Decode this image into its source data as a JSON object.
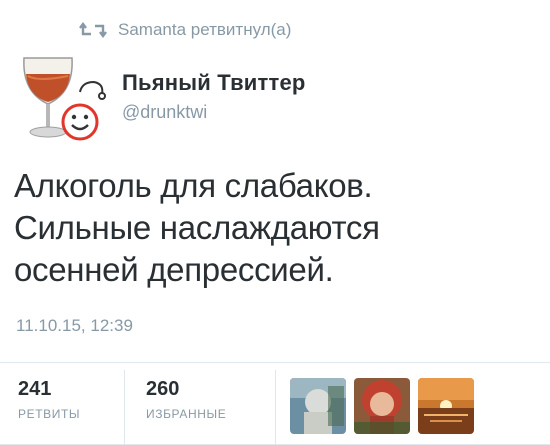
{
  "retweet_context": {
    "icon": "retweet-icon",
    "text": "Samanta ретвитнул(а)"
  },
  "author": {
    "name": "Пьяный Твиттер",
    "username": "@drunktwi"
  },
  "tweet": {
    "text": "Алкоголь для слабаков.\nСильные наслаждаются\nосенней депрессией.",
    "timestamp": "11.10.15, 12:39"
  },
  "stats": {
    "retweets": {
      "count": "241",
      "label": "РЕТВИТЫ"
    },
    "favorites": {
      "count": "260",
      "label": "ИЗБРАННЫЕ"
    }
  },
  "favorited_by": [
    {
      "name": "fav-avatar-1"
    },
    {
      "name": "fav-avatar-2"
    },
    {
      "name": "fav-avatar-3"
    }
  ],
  "colors": {
    "text": "#292f33",
    "secondary": "#8899a6",
    "divider": "#e1e8ed"
  }
}
